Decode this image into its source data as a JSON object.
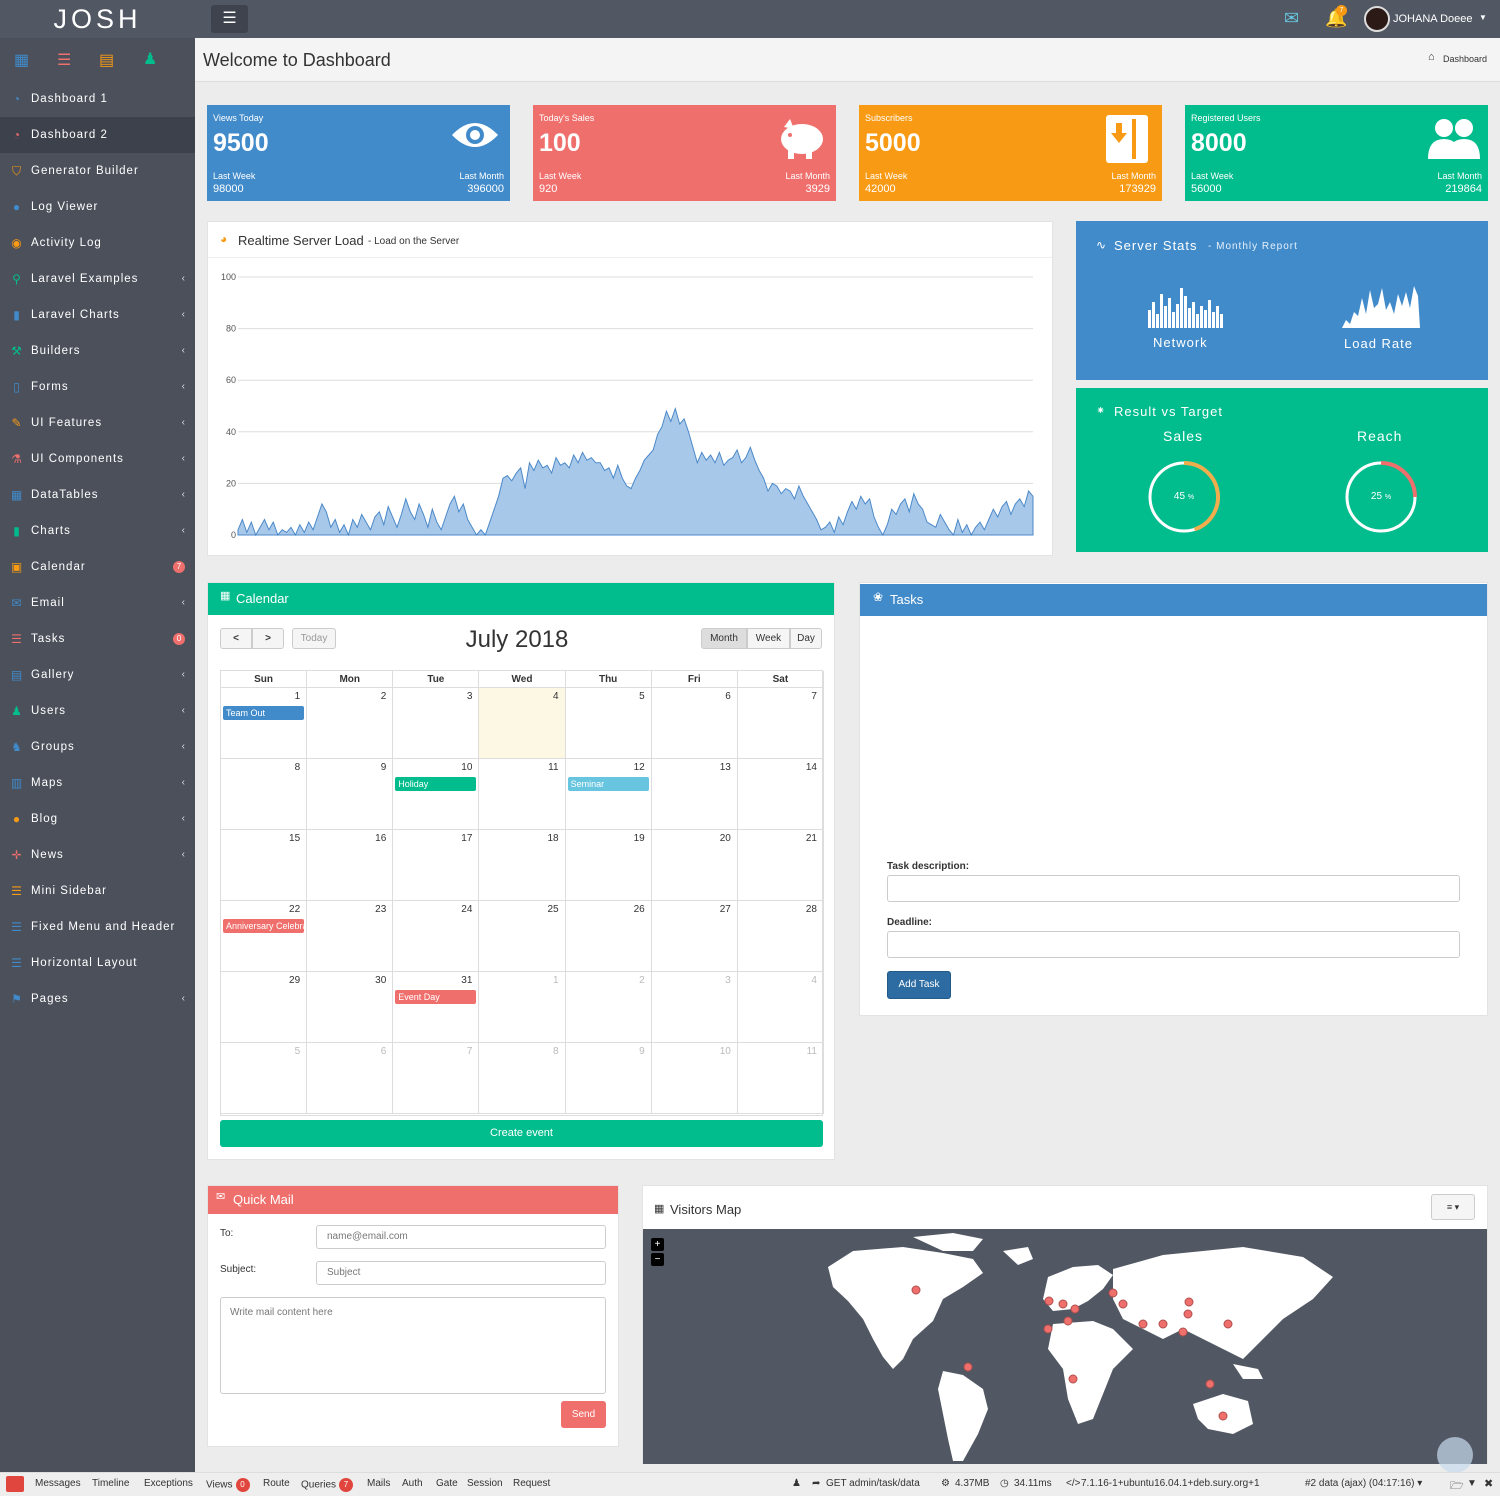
{
  "app": {
    "logo": "JOSH",
    "user_name": "JOHANA Doeee",
    "notif_count": "7"
  },
  "sidebar": {
    "items": [
      {
        "label": "Dashboard 1",
        "icon": "dashboard-icon",
        "chev": "",
        "badge": ""
      },
      {
        "label": "Dashboard 2",
        "icon": "dashboard-icon",
        "chev": "",
        "badge": ""
      },
      {
        "label": "Generator Builder",
        "icon": "shield-icon",
        "chev": "",
        "badge": ""
      },
      {
        "label": "Log Viewer",
        "icon": "globe-icon",
        "chev": "",
        "badge": ""
      },
      {
        "label": "Activity Log",
        "icon": "eye-icon",
        "chev": "",
        "badge": ""
      },
      {
        "label": "Laravel Examples",
        "icon": "pin-icon",
        "chev": "‹",
        "badge": ""
      },
      {
        "label": "Laravel Charts",
        "icon": "bar-chart-icon",
        "chev": "‹",
        "badge": ""
      },
      {
        "label": "Builders",
        "icon": "wrench-icon",
        "chev": "‹",
        "badge": ""
      },
      {
        "label": "Forms",
        "icon": "file-icon",
        "chev": "‹",
        "badge": ""
      },
      {
        "label": "UI Features",
        "icon": "pencil-icon",
        "chev": "‹",
        "badge": ""
      },
      {
        "label": "UI Components",
        "icon": "flask-icon",
        "chev": "‹",
        "badge": ""
      },
      {
        "label": "DataTables",
        "icon": "table-icon",
        "chev": "‹",
        "badge": ""
      },
      {
        "label": "Charts",
        "icon": "bar-chart-icon",
        "chev": "‹",
        "badge": ""
      },
      {
        "label": "Calendar",
        "icon": "calendar-icon",
        "chev": "",
        "badge": "7"
      },
      {
        "label": "Email",
        "icon": "envelope-icon",
        "chev": "‹",
        "badge": ""
      },
      {
        "label": "Tasks",
        "icon": "list-icon",
        "chev": "",
        "badge": "0"
      },
      {
        "label": "Gallery",
        "icon": "image-icon",
        "chev": "‹",
        "badge": ""
      },
      {
        "label": "Users",
        "icon": "user-icon",
        "chev": "‹",
        "badge": ""
      },
      {
        "label": "Groups",
        "icon": "group-icon",
        "chev": "‹",
        "badge": ""
      },
      {
        "label": "Maps",
        "icon": "map-icon",
        "chev": "‹",
        "badge": ""
      },
      {
        "label": "Blog",
        "icon": "comment-icon",
        "chev": "‹",
        "badge": ""
      },
      {
        "label": "News",
        "icon": "move-icon",
        "chev": "‹",
        "badge": ""
      },
      {
        "label": "Mini Sidebar",
        "icon": "list-icon",
        "chev": "",
        "badge": ""
      },
      {
        "label": "Fixed Menu and Header",
        "icon": "list-icon",
        "chev": "",
        "badge": ""
      },
      {
        "label": "Horizontal Layout",
        "icon": "list-icon",
        "chev": "",
        "badge": ""
      },
      {
        "label": "Pages",
        "icon": "flag-icon",
        "chev": "‹",
        "badge": ""
      }
    ]
  },
  "page": {
    "title": "Welcome to Dashboard",
    "breadcrumb": "Dashboard"
  },
  "stats": [
    {
      "title": "Views Today",
      "value": "9500",
      "lw_label": "Last Week",
      "lw_value": "98000",
      "lm_label": "Last Month",
      "lm_value": "396000",
      "color": "#418bca",
      "icon": "eye-icon"
    },
    {
      "title": "Today's Sales",
      "value": "100",
      "lw_label": "Last Week",
      "lw_value": "920",
      "lm_label": "Last Month",
      "lm_value": "3929",
      "color": "#ef6f6c",
      "icon": "piggy-bank-icon"
    },
    {
      "title": "Subscribers",
      "value": "5000",
      "lw_label": "Last Week",
      "lw_value": "42000",
      "lm_label": "Last Month",
      "lm_value": "173929",
      "color": "#f89a14",
      "icon": "archive-icon"
    },
    {
      "title": "Registered Users",
      "value": "8000",
      "lw_label": "Last Week",
      "lw_value": "56000",
      "lm_label": "Last Month",
      "lm_value": "219864",
      "color": "#01bc8c",
      "icon": "users-icon"
    }
  ],
  "server_load": {
    "title": "Realtime Server Load",
    "subtitle": "- Load on the Server"
  },
  "chart_data": {
    "type": "area",
    "title": "",
    "xlabel": "",
    "ylabel": "",
    "ylim": [
      0,
      100
    ],
    "yticks": [
      0,
      20,
      40,
      60,
      80,
      100
    ],
    "values": [
      2,
      6,
      1,
      5,
      0,
      3,
      6,
      2,
      5,
      0,
      2,
      1,
      3,
      0,
      4,
      1,
      5,
      2,
      7,
      12,
      9,
      3,
      6,
      1,
      4,
      0,
      6,
      3,
      8,
      5,
      2,
      7,
      9,
      4,
      11,
      7,
      3,
      8,
      14,
      9,
      6,
      12,
      8,
      3,
      10,
      5,
      2,
      7,
      12,
      15,
      9,
      12,
      6,
      3,
      0,
      2,
      0,
      5,
      10,
      15,
      22,
      23,
      21,
      24,
      26,
      18,
      28,
      25,
      29,
      26,
      27,
      24,
      30,
      27,
      28,
      26,
      31,
      28,
      32,
      29,
      30,
      28,
      28,
      25,
      26,
      22,
      27,
      22,
      19,
      18,
      22,
      25,
      29,
      31,
      33,
      39,
      42,
      48,
      44,
      49,
      43,
      45,
      40,
      34,
      28,
      32,
      29,
      31,
      28,
      32,
      27,
      29,
      30,
      33,
      28,
      30,
      34,
      29,
      25,
      22,
      17,
      20,
      19,
      16,
      18,
      17,
      14,
      19,
      15,
      12,
      9,
      6,
      2,
      3,
      5,
      1,
      7,
      4,
      9,
      13,
      10,
      15,
      12,
      14,
      7,
      3,
      0,
      4,
      10,
      8,
      12,
      14,
      9,
      16,
      12,
      10,
      5,
      4,
      3,
      8,
      5,
      2,
      0,
      6,
      1,
      4,
      0,
      3,
      5,
      2,
      6,
      10,
      7,
      11,
      13,
      8,
      12,
      14,
      11,
      17,
      15
    ]
  },
  "server_stats": {
    "title": "Server Stats",
    "subtitle": "- Monthly Report",
    "network_label": "Network",
    "load_label": "Load Rate"
  },
  "result_target": {
    "title": "Result vs Target",
    "sales_label": "Sales",
    "sales_value": "45",
    "reach_label": "Reach",
    "reach_value": "25",
    "pct_sign": "%"
  },
  "calendar": {
    "header": "Calendar",
    "month_title": "July 2018",
    "today_label": "Today",
    "prev_label": "<",
    "next_label": ">",
    "view_month": "Month",
    "view_week": "Week",
    "view_day": "Day",
    "day_names": [
      "Sun",
      "Mon",
      "Tue",
      "Wed",
      "Thu",
      "Fri",
      "Sat"
    ],
    "weeks": [
      [
        "1",
        "2",
        "3",
        "4",
        "5",
        "6",
        "7"
      ],
      [
        "8",
        "9",
        "10",
        "11",
        "12",
        "13",
        "14"
      ],
      [
        "15",
        "16",
        "17",
        "18",
        "19",
        "20",
        "21"
      ],
      [
        "22",
        "23",
        "24",
        "25",
        "26",
        "27",
        "28"
      ],
      [
        "29",
        "30",
        "31",
        "1",
        "2",
        "3",
        "4"
      ],
      [
        "5",
        "6",
        "7",
        "8",
        "9",
        "10",
        "11"
      ]
    ],
    "events": [
      {
        "title": "Team Out",
        "week": 0,
        "day": 0,
        "color": "#418bca"
      },
      {
        "title": "Holiday",
        "week": 1,
        "day": 2,
        "color": "#01bc8c"
      },
      {
        "title": "Seminar",
        "week": 1,
        "day": 4,
        "color": "#67c5df"
      },
      {
        "title": "Anniversary Celebration",
        "week": 3,
        "day": 0,
        "color": "#ef6f6c"
      },
      {
        "title": "Event Day",
        "week": 4,
        "day": 2,
        "color": "#ef6f6c"
      }
    ],
    "create_label": "Create event"
  },
  "tasks": {
    "header": "Tasks",
    "desc_label": "Task description:",
    "deadline_label": "Deadline:",
    "add_label": "Add Task"
  },
  "quick_mail": {
    "header": "Quick Mail",
    "to_label": "To:",
    "to_placeholder": "name@email.com",
    "subject_label": "Subject:",
    "subject_placeholder": "Subject",
    "body_placeholder": "Write mail content here",
    "send_label": "Send"
  },
  "visitors_map": {
    "header": "Visitors Map",
    "zoom_in": "+",
    "zoom_out": "−"
  },
  "debugbar": {
    "tabs": [
      {
        "label": "Messages",
        "badge": ""
      },
      {
        "label": "Timeline",
        "badge": ""
      },
      {
        "label": "Exceptions",
        "badge": ""
      },
      {
        "label": "Views",
        "badge": "0"
      },
      {
        "label": "Route",
        "badge": ""
      },
      {
        "label": "Queries",
        "badge": "7"
      },
      {
        "label": "Mails",
        "badge": ""
      },
      {
        "label": "Auth",
        "badge": ""
      },
      {
        "label": "Gate",
        "badge": ""
      },
      {
        "label": "Session",
        "badge": ""
      },
      {
        "label": "Request",
        "badge": ""
      }
    ],
    "route": "GET admin/task/data",
    "memory": "4.37MB",
    "time": "34.11ms",
    "php": "7.1.16-1+ubuntu16.04.1+deb.sury.org+1",
    "request": "#2 data (ajax) (04:17:16)"
  }
}
